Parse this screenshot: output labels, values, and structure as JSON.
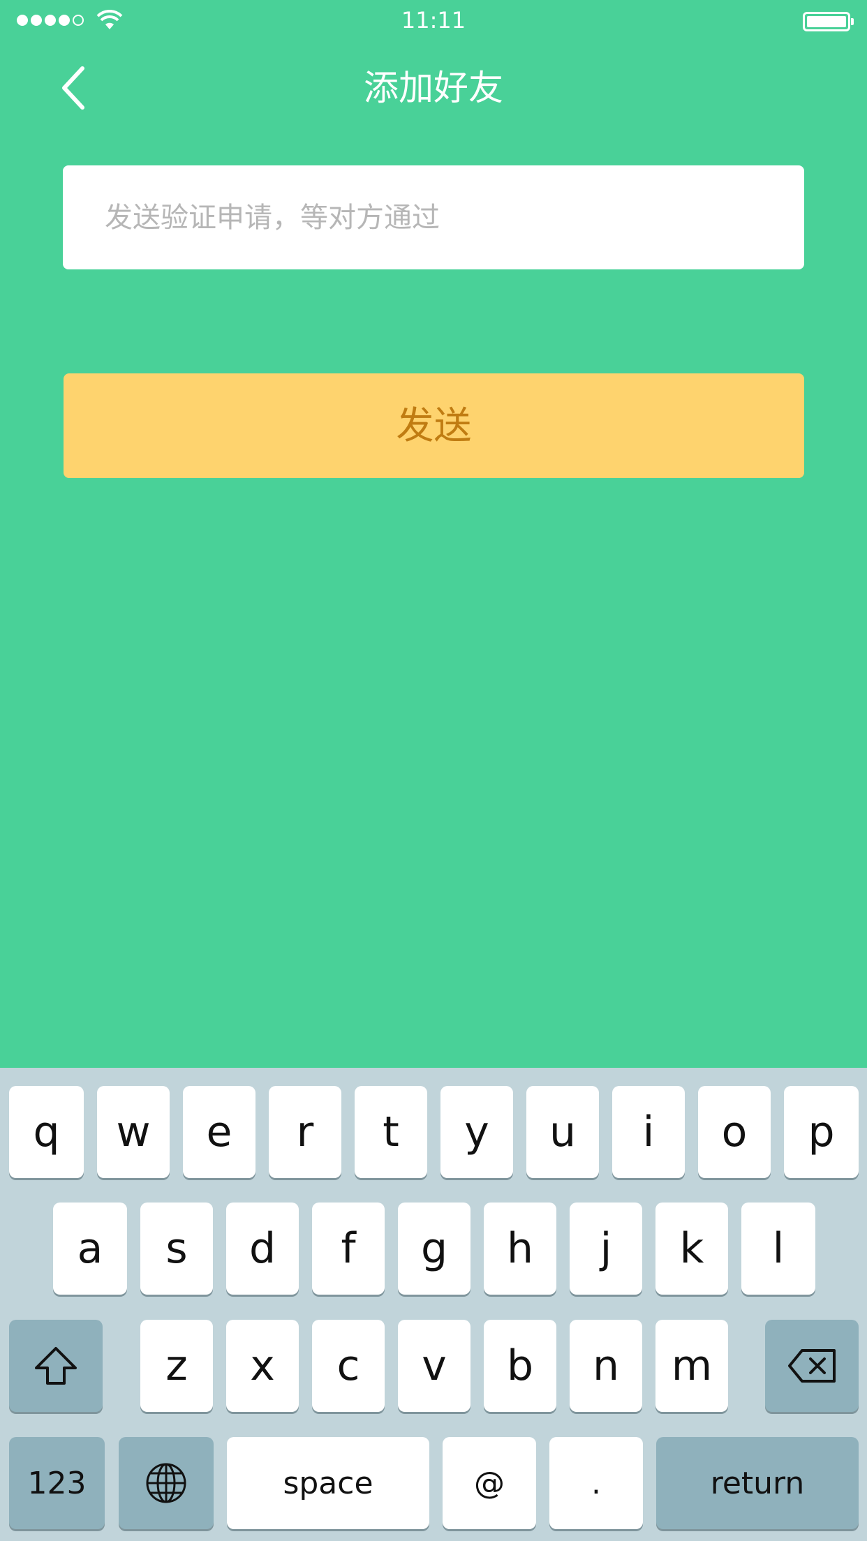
{
  "status_bar": {
    "time": "11:11",
    "signal_dots_filled": 4,
    "signal_dots_total": 5,
    "wifi_icon": "wifi-icon",
    "battery_level": 1.0
  },
  "nav": {
    "title": "添加好友",
    "back_icon": "chevron-left-icon"
  },
  "form": {
    "message_input": {
      "placeholder": "发送验证申请，等对方通过",
      "value": ""
    },
    "send_button_label": "发送"
  },
  "keyboard": {
    "row1": [
      "q",
      "w",
      "e",
      "r",
      "t",
      "y",
      "u",
      "i",
      "o",
      "p"
    ],
    "row2": [
      "a",
      "s",
      "d",
      "f",
      "g",
      "h",
      "j",
      "k",
      "l"
    ],
    "row3": [
      "z",
      "x",
      "c",
      "v",
      "b",
      "n",
      "m"
    ],
    "shift_icon": "shift-icon",
    "delete_icon": "backspace-icon",
    "numbers_label": "123",
    "globe_icon": "globe-icon",
    "space_label": "space",
    "at_label": "@",
    "dot_label": ".",
    "return_label": "return"
  },
  "colors": {
    "background": "#49d198",
    "button": "#fed36e",
    "button_text": "#c07c12",
    "keyboard": "#c1d4da"
  }
}
